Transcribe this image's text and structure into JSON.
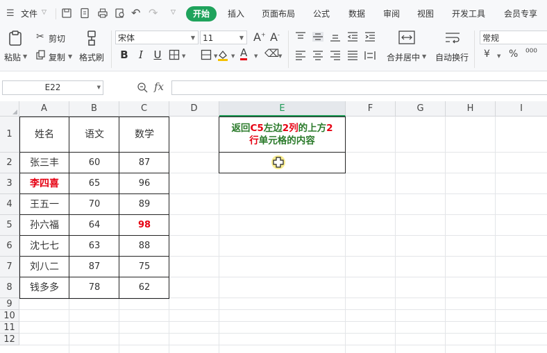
{
  "menubar": {
    "file_label": "文件",
    "tabs": [
      "开始",
      "插入",
      "页面布局",
      "公式",
      "数据",
      "审阅",
      "视图",
      "开发工具",
      "会员专享"
    ],
    "active_tab": "开始"
  },
  "ribbon": {
    "paste": "粘贴",
    "cut": "剪切",
    "copy": "复制",
    "format_painter": "格式刷",
    "font_name": "宋体",
    "font_size": "11",
    "merge_center": "合并居中",
    "wrap_text": "自动换行",
    "number_format": "常规",
    "currency_symbol": "¥",
    "percent_symbol": "%",
    "thousands_symbol": "⁰⁰⁰"
  },
  "formula_bar": {
    "name_box": "E22",
    "fx_label": "fx",
    "formula": ""
  },
  "sheet": {
    "columns": [
      "A",
      "B",
      "C",
      "D",
      "E",
      "F",
      "G",
      "H",
      "I"
    ],
    "selected_column": "E",
    "rows": [
      "1",
      "2",
      "3",
      "4",
      "5",
      "6",
      "7",
      "8",
      "9",
      "10",
      "11",
      "12"
    ],
    "table_header": [
      "姓名",
      "语文",
      "数学"
    ],
    "table_rows": [
      [
        "张三丰",
        "60",
        "87"
      ],
      [
        "李四喜",
        "65",
        "96"
      ],
      [
        "王五一",
        "70",
        "89"
      ],
      [
        "孙六福",
        "64",
        "98"
      ],
      [
        "沈七七",
        "63",
        "88"
      ],
      [
        "刘八二",
        "87",
        "75"
      ],
      [
        "钱多多",
        "78",
        "62"
      ]
    ],
    "question_parts": [
      "返回",
      "C5",
      "左边",
      "2列",
      "的上方",
      "2",
      "行",
      "单元格的内容"
    ],
    "answer": ""
  },
  "colors": {
    "accent": "#1fa35c",
    "highlight_red": "#e60012",
    "highlight_green": "#2a7a2a"
  }
}
